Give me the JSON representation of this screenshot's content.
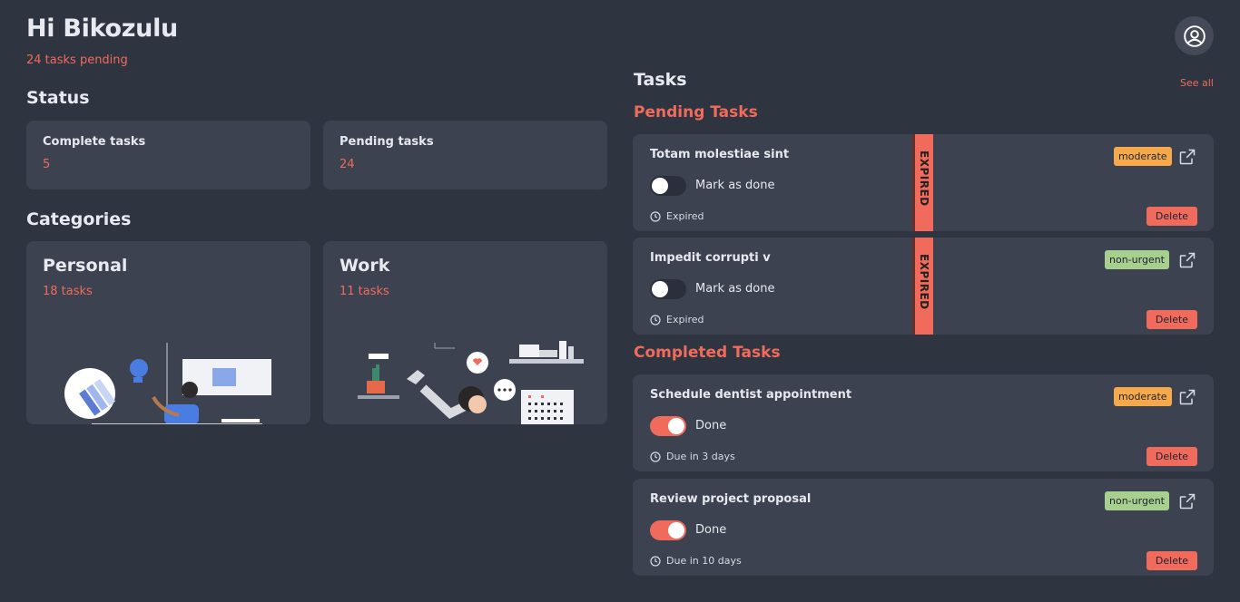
{
  "header": {
    "greeting": "Hi Bikozulu",
    "pending_summary": "24 tasks pending"
  },
  "status": {
    "title": "Status",
    "cards": [
      {
        "label": "Complete tasks",
        "value": "5"
      },
      {
        "label": "Pending tasks",
        "value": "24"
      }
    ]
  },
  "categories": {
    "title": "Categories",
    "items": [
      {
        "name": "Personal",
        "count": "18 tasks"
      },
      {
        "name": "Work",
        "count": "11 tasks"
      }
    ]
  },
  "tasks": {
    "title": "Tasks",
    "see_all": "See all",
    "pending_title": "Pending Tasks",
    "completed_title": "Completed Tasks",
    "pending": [
      {
        "title": "Totam molestiae sint",
        "priority": "moderate",
        "toggle_label": "Mark as done",
        "due": "Expired",
        "strip": "EXPIRED",
        "delete": "Delete"
      },
      {
        "title": "Impedit corrupti v",
        "priority": "non-urgent",
        "toggle_label": "Mark as done",
        "due": "Expired",
        "strip": "EXPIRED",
        "delete": "Delete"
      }
    ],
    "completed": [
      {
        "title": "Schedule dentist appointment",
        "priority": "moderate",
        "toggle_label": "Done",
        "due": "Due in 3 days",
        "delete": "Delete"
      },
      {
        "title": "Review project proposal",
        "priority": "non-urgent",
        "toggle_label": "Done",
        "due": "Due in 10 days",
        "delete": "Delete"
      }
    ]
  },
  "colors": {
    "background": "#2f3441",
    "card": "#3d4250",
    "accent": "#f06b5b",
    "moderate": "#f6a94a",
    "non_urgent": "#a7cf8d"
  },
  "icons": [
    "user-circle-icon",
    "external-link-icon",
    "clock-icon"
  ]
}
